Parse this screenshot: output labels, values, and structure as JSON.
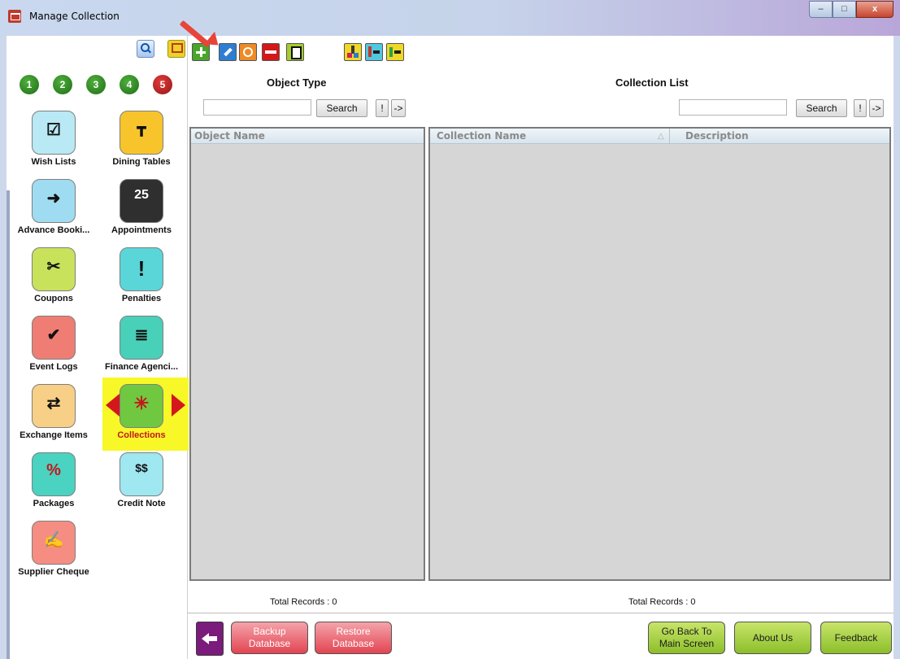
{
  "window": {
    "title": "Manage Collection",
    "controls": {
      "minimize": "–",
      "maximize": "□",
      "close": "x"
    }
  },
  "sidebar": {
    "tools": [
      "search-icon",
      "windows-icon"
    ],
    "numbers": [
      "1",
      "2",
      "3",
      "4",
      "5"
    ],
    "items": [
      {
        "label": "Wish Lists",
        "icon": "checklist-icon",
        "color": "#b8e9f4"
      },
      {
        "label": "Dining Tables",
        "icon": "dining-table-icon",
        "color": "#f7c52b"
      },
      {
        "label": "Advance Booki...",
        "icon": "calendar-arrow-icon",
        "color": "#9fdcf1"
      },
      {
        "label": "Appointments",
        "icon": "calendar-25-icon",
        "color": "#2f2f2f"
      },
      {
        "label": "Coupons",
        "icon": "scissors-coupon-icon",
        "color": "#c8e25b"
      },
      {
        "label": "Penalties",
        "icon": "warning-icon",
        "color": "#5ad6d9"
      },
      {
        "label": "Event Logs",
        "icon": "calendar-check-icon",
        "color": "#ef7d73"
      },
      {
        "label": "Finance Agenci...",
        "icon": "money-stack-icon",
        "color": "#49d0b9"
      },
      {
        "label": "Exchange Items",
        "icon": "exchange-icon",
        "color": "#f7cf86"
      },
      {
        "label": "Collections",
        "icon": "collapse-arrows-icon",
        "color": "#70c841"
      },
      {
        "label": "Packages",
        "icon": "percent-bag-icon",
        "color": "#49d3c0"
      },
      {
        "label": "Credit Note",
        "icon": "factory-dollar-icon",
        "color": "#9fe7f1"
      },
      {
        "label": "Supplier Cheque",
        "icon": "cheque-icon",
        "color": "#f58d83"
      }
    ],
    "selected_label": "Collections",
    "glyphs": {
      "appointments": "25",
      "penalties": "!",
      "packages": "%",
      "credit_note": "$$"
    }
  },
  "toolbar": {
    "buttons": [
      "add-icon",
      "edit-icon",
      "find-icon",
      "delete-icon",
      "copy-icon",
      "import-icon",
      "move-up-icon",
      "move-down-icon"
    ]
  },
  "left_panel": {
    "title": "Object Type",
    "search_value": "",
    "search_button": "Search",
    "excl_button": "!",
    "arrow_button": "->",
    "column": "Object Name",
    "total": "Total Records : 0"
  },
  "right_panel": {
    "title": "Collection List",
    "search_value": "",
    "search_button": "Search",
    "excl_button": "!",
    "arrow_button": "->",
    "columns": [
      "Collection Name",
      "Description"
    ],
    "sort_glyph": "△",
    "total": "Total Records : 0"
  },
  "bottom": {
    "backup_line1": "Backup",
    "backup_line2": "Database",
    "restore_line1": "Restore",
    "restore_line2": "Database",
    "goback_line1": "Go Back To",
    "goback_line2": "Main Screen",
    "about": "About Us",
    "feedback": "Feedback"
  },
  "colors": {
    "accent_green": "#4aa52b",
    "red": "#d4171b",
    "highlight": "#f8f728",
    "panel_gray": "#d6d6d6"
  }
}
